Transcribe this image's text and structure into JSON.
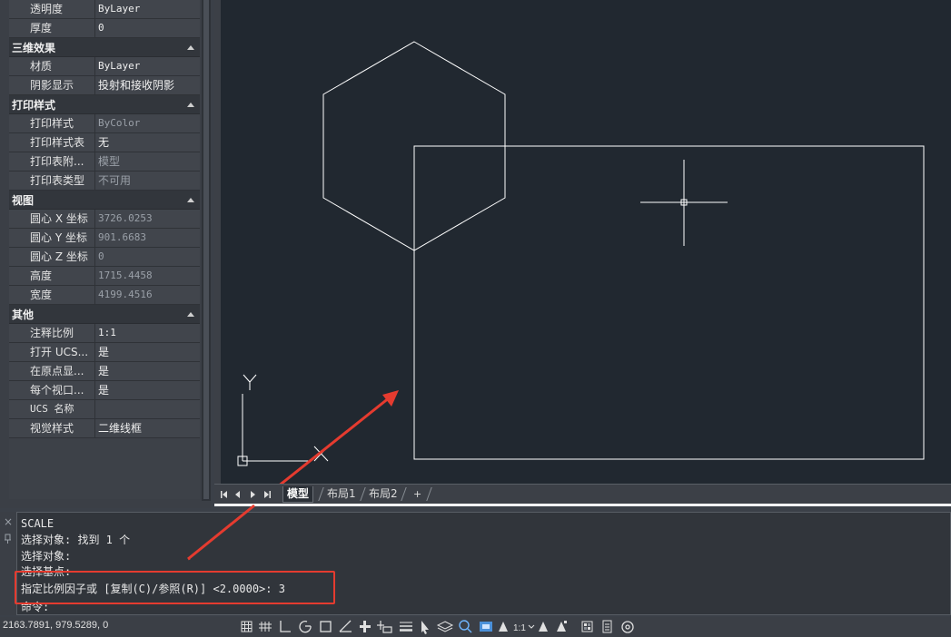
{
  "properties": {
    "groups": [
      {
        "id": "general",
        "title": "",
        "rows": [
          {
            "key": "透明度",
            "value": "ByLayer"
          },
          {
            "key": "厚度",
            "value": "0"
          }
        ]
      },
      {
        "id": "3d",
        "title": "三维效果",
        "rows": [
          {
            "key": "材质",
            "value": "ByLayer"
          },
          {
            "key": "阴影显示",
            "value": "投射和接收阴影"
          }
        ]
      },
      {
        "id": "plot",
        "title": "打印样式",
        "rows": [
          {
            "key": "打印样式",
            "value": "ByColor"
          },
          {
            "key": "打印样式表",
            "value": "无"
          },
          {
            "key": "打印表附...",
            "value": "模型"
          },
          {
            "key": "打印表类型",
            "value": "不可用"
          }
        ]
      },
      {
        "id": "view",
        "title": "视图",
        "rows": [
          {
            "key": "圆心 X 坐标",
            "value": "3726.0253"
          },
          {
            "key": "圆心 Y 坐标",
            "value": "901.6683"
          },
          {
            "key": "圆心 Z 坐标",
            "value": "0"
          },
          {
            "key": "高度",
            "value": "1715.4458"
          },
          {
            "key": "宽度",
            "value": "4199.4516"
          }
        ]
      },
      {
        "id": "misc",
        "title": "其他",
        "rows": [
          {
            "key": "注释比例",
            "value": "1:1"
          },
          {
            "key": "打开 UCS...",
            "value": "是"
          },
          {
            "key": "在原点显...",
            "value": "是"
          },
          {
            "key": "每个视口...",
            "value": "是"
          },
          {
            "key": "UCS 名称",
            "value": ""
          },
          {
            "key": "视觉样式",
            "value": "二维线框"
          }
        ]
      }
    ]
  },
  "ucs": {
    "x_label": "X",
    "y_label": "Y"
  },
  "tabs": {
    "model": "模型",
    "layout1": "布局1",
    "layout2": "布局2",
    "add": "+"
  },
  "command": {
    "lines": [
      "SCALE",
      "选择对象: 找到 1 个",
      "选择对象:",
      "选择基点:",
      "指定比例因子或 [复制(C)/参照(R)] <2.0000>:  3",
      "命令:"
    ],
    "close_glyph": "×"
  },
  "status": {
    "coordinates": "2163.7891, 979.5289, 0",
    "annotation_scale": "1:1"
  },
  "colors": {
    "highlight": "#e53b2f",
    "arrow": "#e53b2f",
    "geometry": "#ffffff"
  }
}
